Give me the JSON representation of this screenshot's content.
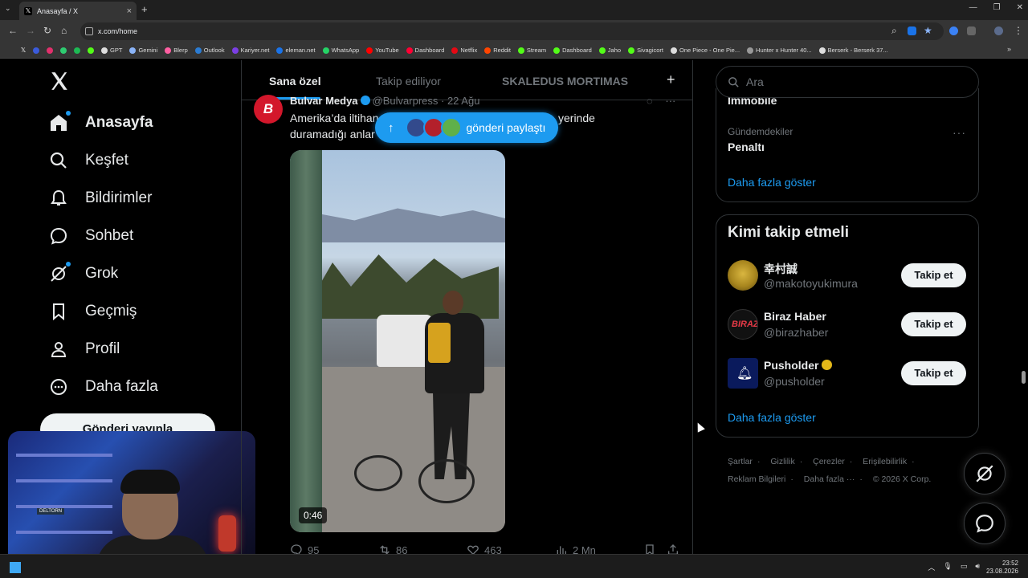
{
  "browser": {
    "tab_title": "Anasayfa / X",
    "tab_close": "×",
    "new_tab": "+",
    "url": "x.com/home",
    "bookmarks": [
      {
        "label": "GPT",
        "color": "#cccccc"
      },
      {
        "label": "Gemini",
        "color": "#8ab4f8"
      },
      {
        "label": "Blerp",
        "color": "#ff5fa2"
      },
      {
        "label": "Outlook",
        "color": "#2b7cd3"
      },
      {
        "label": "Kariyer.net",
        "color": "#7b3fe4"
      },
      {
        "label": "eleman.net",
        "color": "#1a73e8"
      },
      {
        "label": "WhatsApp",
        "color": "#25d366"
      },
      {
        "label": "YouTube",
        "color": "#ff0000"
      },
      {
        "label": "Dashboard",
        "color": "#ff0033"
      },
      {
        "label": "Netflix",
        "color": "#e50914"
      },
      {
        "label": "Reddit",
        "color": "#ff4500"
      },
      {
        "label": "Stream",
        "color": "#53fc18"
      },
      {
        "label": "Dashboard",
        "color": "#53fc18"
      },
      {
        "label": "Jaho",
        "color": "#53fc18"
      },
      {
        "label": "Sivagicort",
        "color": "#53fc18"
      },
      {
        "label": "One Piece - One Pie...",
        "color": "#dddddd"
      },
      {
        "label": "Hunter x Hunter 40...",
        "color": "#999999"
      },
      {
        "label": "Berserk - Berserk 37...",
        "color": "#dddddd"
      }
    ]
  },
  "nav": {
    "items": [
      {
        "label": "Anasayfa",
        "icon": "home-icon",
        "badge": true
      },
      {
        "label": "Keşfet",
        "icon": "search-icon",
        "badge": false
      },
      {
        "label": "Bildirimler",
        "icon": "bell-icon",
        "badge": false
      },
      {
        "label": "Sohbet",
        "icon": "chat-icon",
        "badge": false
      },
      {
        "label": "Grok",
        "icon": "grok-icon",
        "badge": true
      },
      {
        "label": "Geçmiş",
        "icon": "bookmark-icon",
        "badge": false
      },
      {
        "label": "Profil",
        "icon": "profile-icon",
        "badge": false
      },
      {
        "label": "Daha fazla",
        "icon": "more-circle-icon",
        "badge": false
      }
    ],
    "post_button": "Gönderi yayınla"
  },
  "webcam": {
    "shelf_label": "DELTORN"
  },
  "timeline": {
    "tabs": [
      "Sana özel",
      "Takip ediliyor",
      "SKALEDUS MORTIMAS"
    ],
    "plus": "+"
  },
  "tweet": {
    "avatar_letter": "B",
    "name": "Bulvar Medya",
    "handle": "@Bulvarpress",
    "date": "· 22 Ağu",
    "text_line1": "Amerika’da iltihan",
    "text_line1_end": "aki veren adam, yerinde",
    "text_line2": "duramadığı anlar",
    "duration": "0:46",
    "replies": "95",
    "reposts": "86",
    "likes": "463",
    "views": "2 Mn"
  },
  "new_posts_pill": {
    "label": "gönderi paylaştı"
  },
  "sidebar": {
    "search_placeholder": "Ara",
    "trend_cut": "İmmobile",
    "trend_category": "Gündemdekiler",
    "trend_name": "Penaltı",
    "trend_more": "···",
    "trends_show_more": "Daha fazla göster",
    "follow_title": "Kimi takip etmeli",
    "suggestions": [
      {
        "name": "幸村誠",
        "handle": "@makotoyukimura",
        "button": "Takip et",
        "verified": false
      },
      {
        "name": "Biraz Haber",
        "handle": "@birazhaber",
        "button": "Takip et",
        "verified": false
      },
      {
        "name": "Pusholder",
        "handle": "@pusholder",
        "button": "Takip et",
        "verified": true
      }
    ],
    "follow_show_more": "Daha fazla göster",
    "footer": [
      "Şartlar",
      "Gizlilik",
      "Çerezler",
      "Erişilebilirlik",
      "Reklam Bilgileri",
      "Daha fazla ···",
      "© 2026 X Corp."
    ]
  },
  "taskbar": {
    "time": "23:52",
    "date": "23.08.2026"
  },
  "colors": {
    "accent": "#1d9bf0",
    "background": "#000000",
    "text": "#e7e9ea",
    "muted": "#71767b",
    "border": "#2f3336"
  }
}
